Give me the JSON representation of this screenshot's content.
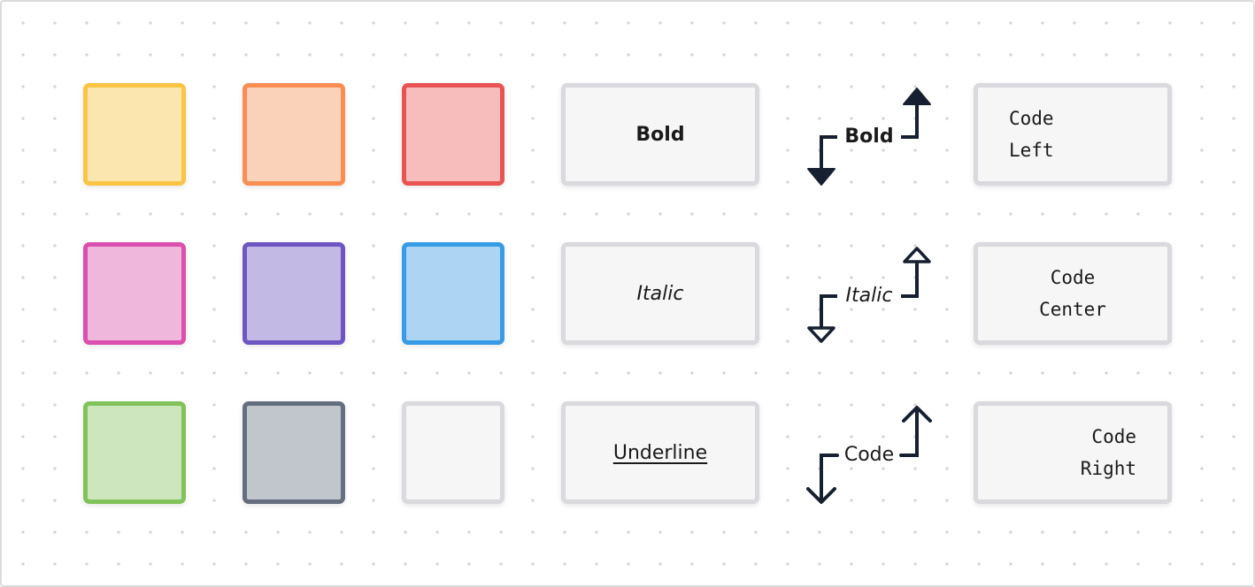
{
  "swatches": [
    {
      "name": "yellow",
      "stroke": "#fac444",
      "fill": "#fce6b0"
    },
    {
      "name": "orange",
      "stroke": "#f98e52",
      "fill": "#fad1b9"
    },
    {
      "name": "red",
      "stroke": "#e85453",
      "fill": "#f7bdbd"
    },
    {
      "name": "pink",
      "stroke": "#db4fae",
      "fill": "#f0b7dc"
    },
    {
      "name": "purple",
      "stroke": "#6d56c2",
      "fill": "#c2b9e4"
    },
    {
      "name": "blue",
      "stroke": "#379be6",
      "fill": "#aed4f4"
    },
    {
      "name": "green",
      "stroke": "#81c35a",
      "fill": "#cde6bd"
    },
    {
      "name": "gray",
      "stroke": "#656e7e",
      "fill": "#c1c5cc"
    },
    {
      "name": "white",
      "stroke": "#d9d9de",
      "fill": "#f6f6f6"
    }
  ],
  "text_boxes": [
    {
      "label": "Bold",
      "style": "bold"
    },
    {
      "label": "Italic",
      "style": "italic"
    },
    {
      "label": "Underline",
      "style": "underline"
    }
  ],
  "connectors": [
    {
      "label": "Bold",
      "style": "bold",
      "arrowhead": "filled-triangle"
    },
    {
      "label": "Italic",
      "style": "italic",
      "arrowhead": "hollow-triangle"
    },
    {
      "label": "Code",
      "style": "normal",
      "arrowhead": "open-chevron"
    }
  ],
  "code_boxes": [
    {
      "line1": "Code",
      "line2": "Left",
      "align": "left"
    },
    {
      "line1": "Code",
      "line2": "Center",
      "align": "center"
    },
    {
      "line1": "Code",
      "line2": "Right",
      "align": "right"
    }
  ],
  "colors": {
    "connector": "#172030",
    "canvas_dots": "#d6d6d6",
    "frame_border": "#dcdcdc"
  }
}
